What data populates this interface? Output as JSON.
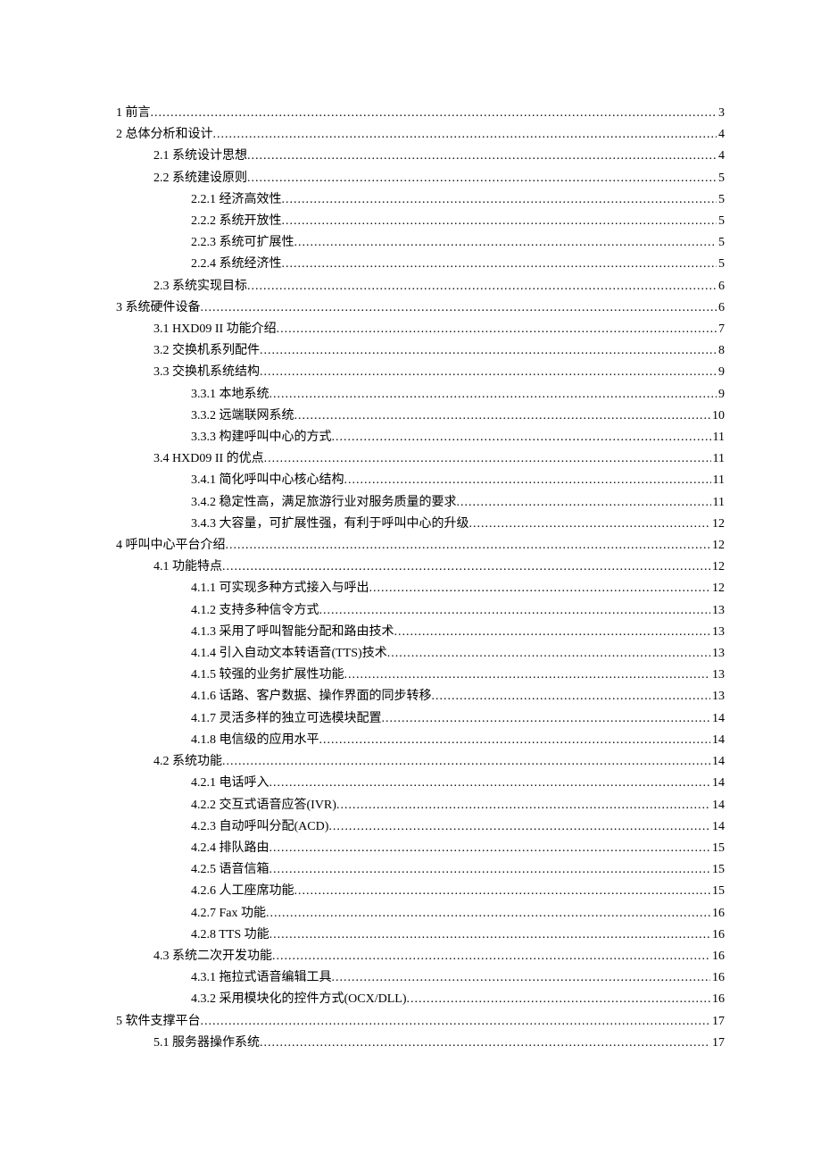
{
  "toc": [
    {
      "level": 1,
      "title": "1  前言",
      "page": "3"
    },
    {
      "level": 1,
      "title": "2  总体分析和设计",
      "page": "4"
    },
    {
      "level": 2,
      "title": "2.1  系统设计思想",
      "page": "4"
    },
    {
      "level": 2,
      "title": "2.2  系统建设原则",
      "page": "5"
    },
    {
      "level": 3,
      "title": "2.2.1 经济高效性",
      "page": "5"
    },
    {
      "level": 3,
      "title": "2.2.2  系统开放性",
      "page": "5"
    },
    {
      "level": 3,
      "title": "2.2.3 系统可扩展性",
      "page": "5"
    },
    {
      "level": 3,
      "title": "2.2.4  系统经济性",
      "page": "5"
    },
    {
      "level": 2,
      "title": "2.3  系统实现目标",
      "page": "6"
    },
    {
      "level": 1,
      "title": "3  系统硬件设备",
      "page": "6"
    },
    {
      "level": 2,
      "title": "3.1 HXD09 II 功能介绍",
      "page": "7"
    },
    {
      "level": 2,
      "title": "3.2  交换机系列配件",
      "page": "8"
    },
    {
      "level": 2,
      "title": "3.3  交换机系统结构",
      "page": "9"
    },
    {
      "level": 3,
      "title": "3.3.1  本地系统",
      "page": "9"
    },
    {
      "level": 3,
      "title": "3.3.2  远端联网系统",
      "page": "10"
    },
    {
      "level": 3,
      "title": "3.3.3  构建呼叫中心的方式",
      "page": "11"
    },
    {
      "level": 2,
      "title": "3.4 HXD09 II 的优点",
      "page": "11"
    },
    {
      "level": 3,
      "title": "3.4.1  简化呼叫中心核心结构",
      "page": "11"
    },
    {
      "level": 3,
      "title": "3.4.2  稳定性高，满足旅游行业对服务质量的要求",
      "page": "11"
    },
    {
      "level": 3,
      "title": "3.4.3  大容量，可扩展性强，有利于呼叫中心的升级",
      "page": "12"
    },
    {
      "level": 1,
      "title": "4  呼叫中心平台介绍",
      "page": "12"
    },
    {
      "level": 2,
      "title": "4.1  功能特点",
      "page": "12"
    },
    {
      "level": 3,
      "title": "4.1.1 可实现多种方式接入与呼出",
      "page": "12"
    },
    {
      "level": 3,
      "title": "4.1.2 支持多种信令方式",
      "page": "13"
    },
    {
      "level": 3,
      "title": "4.1.3 采用了呼叫智能分配和路由技术",
      "page": "13"
    },
    {
      "level": 3,
      "title": "4.1.4 引入自动文本转语音(TTS)技术",
      "page": "13"
    },
    {
      "level": 3,
      "title": "4.1.5  较强的业务扩展性功能",
      "page": "13"
    },
    {
      "level": 3,
      "title": "4.1.6  话路、客户数据、操作界面的同步转移",
      "page": "13"
    },
    {
      "level": 3,
      "title": "4.1.7  灵活多样的独立可选模块配置",
      "page": "14"
    },
    {
      "level": 3,
      "title": "4.1.8 电信级的应用水平",
      "page": "14"
    },
    {
      "level": 2,
      "title": "4.2  系统功能",
      "page": "14"
    },
    {
      "level": 3,
      "title": "4.2.1  电话呼入",
      "page": "14"
    },
    {
      "level": 3,
      "title": "4.2.2  交互式语音应答(IVR)",
      "page": "14"
    },
    {
      "level": 3,
      "title": "4.2.3  自动呼叫分配(ACD)",
      "page": "14"
    },
    {
      "level": 3,
      "title": "4.2.4  排队路由",
      "page": "15"
    },
    {
      "level": 3,
      "title": "4.2.5  语音信箱",
      "page": "15"
    },
    {
      "level": 3,
      "title": "4.2.6  人工座席功能",
      "page": "15"
    },
    {
      "level": 3,
      "title": "4.2.7 Fax 功能",
      "page": "16"
    },
    {
      "level": 3,
      "title": "4.2.8 TTS 功能",
      "page": "16"
    },
    {
      "level": 2,
      "title": "4.3  系统二次开发功能",
      "page": "16"
    },
    {
      "level": 3,
      "title": "4.3.1  拖拉式语音编辑工具",
      "page": "16"
    },
    {
      "level": 3,
      "title": "4.3.2  采用模块化的控件方式(OCX/DLL)",
      "page": "16"
    },
    {
      "level": 1,
      "title": "5  软件支撑平台",
      "page": "17"
    },
    {
      "level": 2,
      "title": "5.1  服务器操作系统",
      "page": "17"
    }
  ]
}
